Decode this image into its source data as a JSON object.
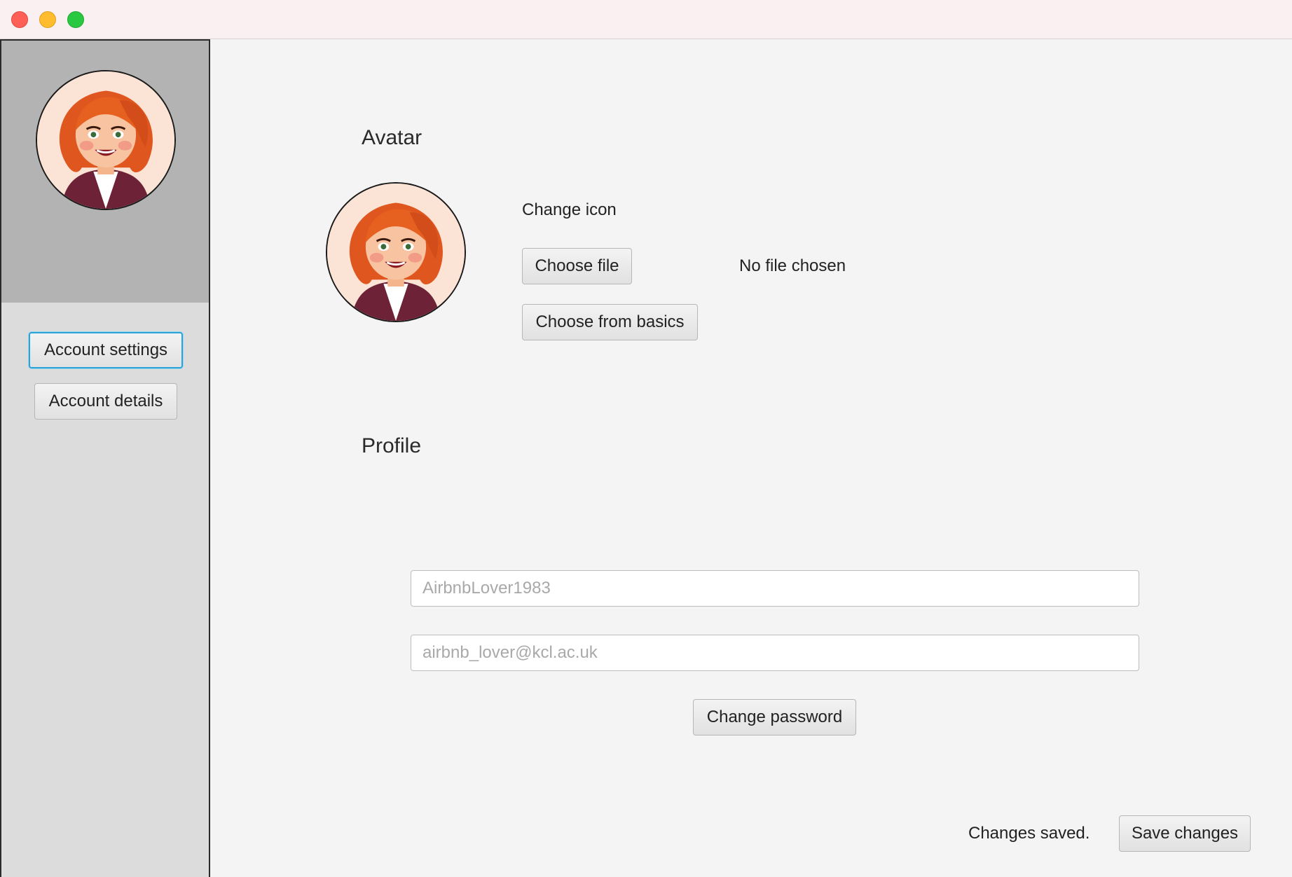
{
  "window": {
    "controls": [
      "close",
      "minimize",
      "maximize"
    ]
  },
  "sidebar": {
    "avatar_icon": "woman-avatar-icon",
    "items": [
      {
        "label": "Account settings",
        "active": true
      },
      {
        "label": "Account details",
        "active": false
      }
    ]
  },
  "avatar_section": {
    "heading": "Avatar",
    "avatar_icon": "woman-avatar-icon",
    "change_icon_label": "Change icon",
    "choose_file_label": "Choose file",
    "file_status": "No file chosen",
    "choose_basics_label": "Choose from basics"
  },
  "profile_section": {
    "heading": "Profile",
    "username_placeholder": "AirbnbLover1983",
    "email_placeholder": "airbnb_lover@kcl.ac.uk",
    "change_password_label": "Change password"
  },
  "footer": {
    "status": "Changes saved.",
    "save_label": "Save changes"
  },
  "colors": {
    "focus_ring": "#2aa4d8",
    "sidebar_top": "#b3b3b3",
    "sidebar_bg": "#dcdcdc",
    "content_bg": "#f4f4f4"
  }
}
